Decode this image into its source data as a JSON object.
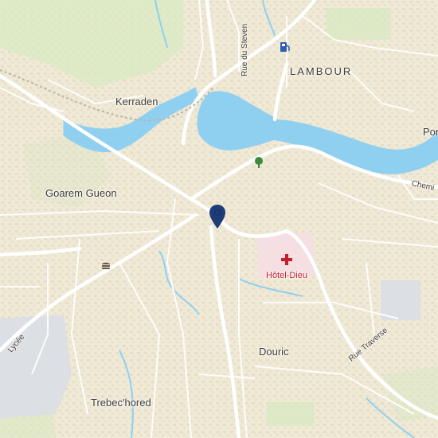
{
  "map": {
    "labels": {
      "lambour": "LAMBOUR",
      "kerraden": "Kerraden",
      "goarem_gueon": "Goarem Gueon",
      "douric": "Douric",
      "trebechored": "Trebec'hored",
      "hotel_dieu": "Hôtel-Dieu",
      "port_partial": "Por",
      "chemin_partial": "Chemi"
    },
    "streets": {
      "rue_du_steven": "Rue du Steven",
      "rue_traverse": "Rue Traverse",
      "lycee_partial": "Lycée"
    },
    "pois": {
      "fuel": "fuel-station-icon",
      "fast_food": "burger-icon",
      "park": "tree-icon",
      "hospital": "red-cross-icon",
      "location": "location-pin-icon"
    },
    "colors": {
      "water": "#8fd0f0",
      "land": "#efe9d6",
      "green": "#d9e9c3",
      "hospital_area": "#f6dfe2",
      "marker": "#1f3b78",
      "hospital_red": "#c8202a"
    }
  }
}
